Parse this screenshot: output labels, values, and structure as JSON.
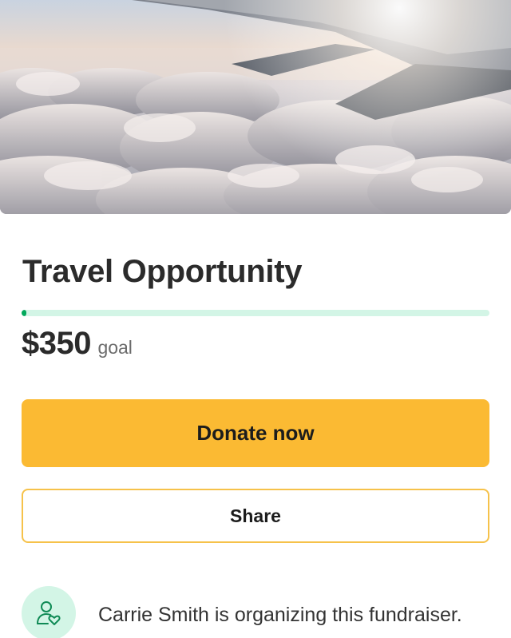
{
  "fundraiser": {
    "title": "Travel Opportunity",
    "goal_amount": "$350",
    "goal_label": "goal",
    "progress_fraction": 0.01
  },
  "actions": {
    "donate_label": "Donate now",
    "share_label": "Share"
  },
  "organizer": {
    "text": "Carrie Smith is organizing this fundraiser.",
    "icon": "user-heart-icon"
  },
  "hero": {
    "icon": "airplane-wing-over-clouds-photo"
  },
  "colors": {
    "accent": "#fbba33",
    "progress_fill": "#02a95c",
    "progress_track": "#d3f5e6",
    "avatar_bg": "#d3f5e6"
  }
}
